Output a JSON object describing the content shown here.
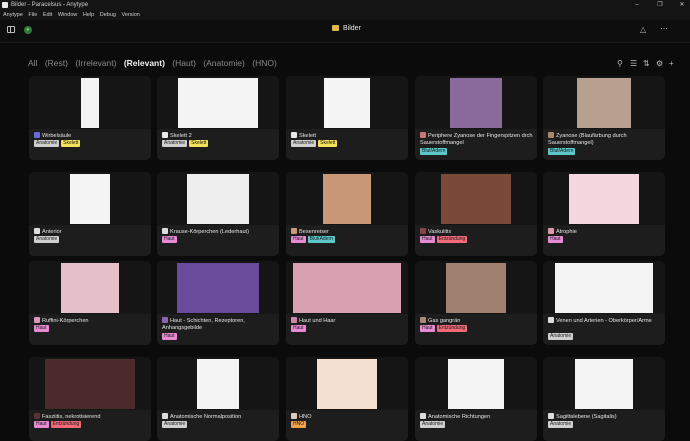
{
  "titlebar": {
    "title": "Bilder - Paracelsus - Anytype"
  },
  "menu": [
    "Anytype",
    "File",
    "Edit",
    "Window",
    "Help",
    "Debug",
    "Version"
  ],
  "header": {
    "space_initial": "P",
    "set_title": "Bilder"
  },
  "tabs": [
    "All",
    "(Rest)",
    "(Irrelevant)",
    "(Relevant)",
    "(Haut)",
    "(Anatomie)",
    "(HNO)"
  ],
  "active_tab": "(Relevant)",
  "colors": {
    "background": "#0b0b0b",
    "card": "#1d1d1d",
    "anatomie": "#cfcfcf",
    "skelett": "#f5e25a",
    "blut": "#5cc7c7",
    "haut": "#e78ad3",
    "entzuendung": "#f06a7a",
    "hno": "#f0a24a"
  },
  "cards": [
    {
      "name": "Wirbelsäule",
      "tags": [
        "Anatomie",
        "Skelett"
      ]
    },
    {
      "name": "Skelett 2",
      "tags": [
        "Anatomie",
        "Skelett"
      ]
    },
    {
      "name": "Skelett",
      "tags": [
        "Anatomie",
        "Skelett"
      ]
    },
    {
      "name": "Periphere Zyanose der Fingerspitzen drch Sauerstoffmangel",
      "tags": [
        "Blut/Adern"
      ]
    },
    {
      "name": "Zyanose (Blaufärbung durch Sauerstoffmangel)",
      "tags": [
        "Blut/Adern"
      ]
    },
    {
      "name": "Anterior",
      "tags": [
        "Anatomie"
      ]
    },
    {
      "name": "Krause-Körperchen (Lederhaut)",
      "tags": [
        "Haut"
      ]
    },
    {
      "name": "Besenreiser",
      "tags": [
        "Haut",
        "Blut/Adern"
      ]
    },
    {
      "name": "Vaskulitis",
      "tags": [
        "Haut",
        "Entzündung"
      ]
    },
    {
      "name": "Atrophie",
      "tags": [
        "Haut"
      ]
    },
    {
      "name": "Ruffini-Körperchen",
      "tags": [
        "Haut"
      ]
    },
    {
      "name": "Haut - Schichten, Rezeptoren, Anhangsgebilde",
      "tags": [
        "Haut"
      ]
    },
    {
      "name": "Haut und Haar",
      "tags": [
        "Haut"
      ]
    },
    {
      "name": "Gas gangrän",
      "tags": [
        "Haut",
        "Entzündung"
      ]
    },
    {
      "name": "Venen und Arterien - Oberkörper/Arme",
      "tags": [
        "Anatomie"
      ]
    },
    {
      "name": "Fasziitis, nekrotisierend",
      "tags": [
        "Haut",
        "Entzündung"
      ]
    },
    {
      "name": "Anatomische Normalposition",
      "tags": [
        "Anatomie"
      ]
    },
    {
      "name": "HNO",
      "tags": [
        "HNO"
      ]
    },
    {
      "name": "Anatomische Richtungen",
      "tags": [
        "Anatomie"
      ]
    },
    {
      "name": "Sagittalebene (Sagitalis)",
      "tags": [
        "Anatomie"
      ]
    }
  ]
}
